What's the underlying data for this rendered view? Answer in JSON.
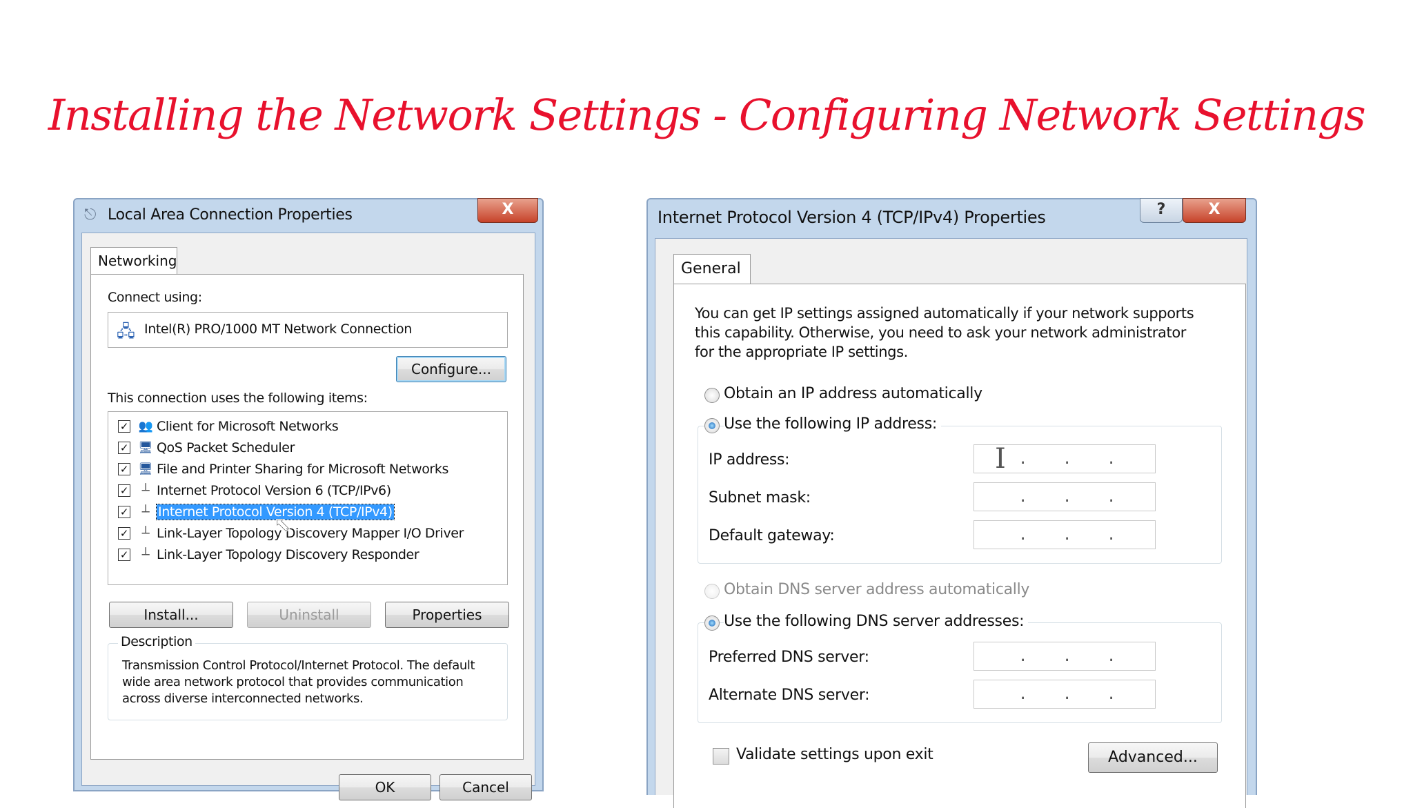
{
  "slide": {
    "title": "Installing the Network Settings - Configuring Network Settings"
  },
  "lan_dialog": {
    "title": "Local Area Connection Properties",
    "close_label": "X",
    "tab": "Networking",
    "connect_using_label": "Connect using:",
    "adapter": "Intel(R) PRO/1000 MT Network Connection",
    "configure_label": "Configure...",
    "items_label": "This connection uses the following items:",
    "items": [
      {
        "label": "Client for Microsoft Networks",
        "checked": true,
        "icon": "network-client-icon"
      },
      {
        "label": "QoS Packet Scheduler",
        "checked": true,
        "icon": "qos-scheduler-icon"
      },
      {
        "label": "File and Printer Sharing for Microsoft Networks",
        "checked": true,
        "icon": "file-sharing-icon"
      },
      {
        "label": "Internet Protocol Version 6 (TCP/IPv6)",
        "checked": true,
        "icon": "protocol-icon"
      },
      {
        "label": "Internet Protocol Version 4 (TCP/IPv4)",
        "checked": true,
        "icon": "protocol-icon",
        "selected": true
      },
      {
        "label": "Link-Layer Topology Discovery Mapper I/O Driver",
        "checked": true,
        "icon": "protocol-icon"
      },
      {
        "label": "Link-Layer Topology Discovery Responder",
        "checked": true,
        "icon": "protocol-icon"
      }
    ],
    "install_label": "Install...",
    "uninstall_label": "Uninstall",
    "properties_label": "Properties",
    "description_label": "Description",
    "description_lines": [
      "Transmission Control Protocol/Internet Protocol. The default",
      "wide area network protocol that provides communication",
      "across diverse interconnected networks."
    ],
    "ok_label": "OK",
    "cancel_label": "Cancel"
  },
  "ipv4_dialog": {
    "title": "Internet Protocol Version 4 (TCP/IPv4) Properties",
    "help_label": "?",
    "close_label": "X",
    "tab": "General",
    "intro_lines": [
      "You can get IP settings assigned automatically if your network supports",
      "this capability. Otherwise, you need to ask your network administrator",
      "for the appropriate IP settings."
    ],
    "obtain_ip_label": "Obtain an IP address automatically",
    "use_ip_label": "Use the following IP address:",
    "ip_address_label": "IP address:",
    "subnet_label": "Subnet mask:",
    "gateway_label": "Default gateway:",
    "obtain_dns_label": "Obtain DNS server address automatically",
    "use_dns_label": "Use the following DNS server addresses:",
    "preferred_dns_label": "Preferred DNS server:",
    "alternate_dns_label": "Alternate DNS server:",
    "validate_label": "Validate settings upon exit",
    "advanced_label": "Advanced...",
    "ip_separator": "."
  }
}
